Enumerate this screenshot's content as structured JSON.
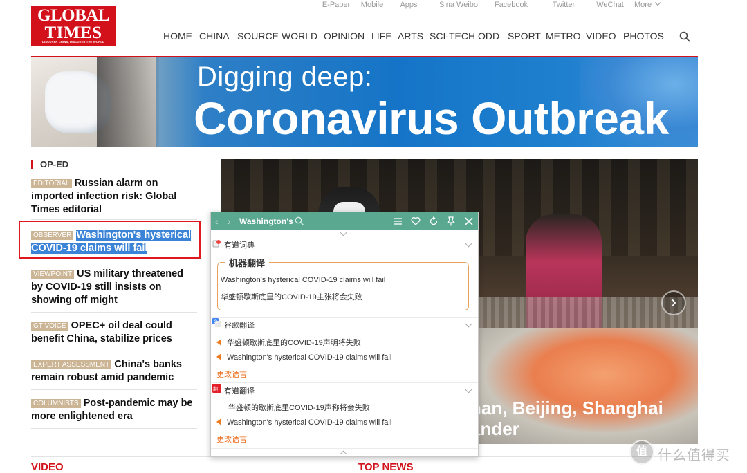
{
  "logo": {
    "line1": "GLOBAL",
    "line2": "TIMES",
    "tagline": "DISCOVER CHINA, DISCOVER THE WORLD"
  },
  "top_links": [
    "E-Paper",
    "Mobile",
    "Apps",
    "Sina Weibo",
    "Facebook",
    "Twitter",
    "WeChat",
    "More"
  ],
  "nav": [
    "HOME",
    "CHINA",
    "SOURCE",
    "WORLD",
    "OPINION",
    "LIFE",
    "ARTS",
    "SCI-TECH",
    "ODD",
    "SPORT",
    "METRO",
    "VIDEO",
    "PHOTOS"
  ],
  "banner": {
    "line1": "Digging deep:",
    "line2": "Coronavirus Outbreak"
  },
  "oped": {
    "title": "OP-ED",
    "stories": [
      {
        "tag": "EDITORIAL",
        "title": "Russian alarm on imported infection risk: Global Times editorial"
      },
      {
        "tag": "OBSERVER",
        "title": "Washington's hysterical COVID-19 claims will fail"
      },
      {
        "tag": "VIEWPOINT",
        "title": "US military threatened by COVID-19 still insists on showing off might"
      },
      {
        "tag": "GT VOICE",
        "title": "OPEC+ oil deal could benefit China, stabilize prices"
      },
      {
        "tag": "EXPERT ASSESSMENT",
        "title": "China's banks remain robust amid pandemic"
      },
      {
        "tag": "COLUMNISTS",
        "title": "Post-pandemic may be more enlightened era"
      }
    ]
  },
  "photo": {
    "caption_line1": "han, Beijing, Shanghai",
    "caption_line2": "ander",
    "next": "›"
  },
  "sections": {
    "video": "VIDEO",
    "top_news": "TOP NEWS"
  },
  "popup": {
    "query": "Washington's",
    "dict_name": "有道词典",
    "machine_title": "机器翻译",
    "machine_en": "Washington's hysterical COVID-19 claims will fail",
    "machine_zh": "华盛顿歇斯底里的COVID-19主张将会失败",
    "google_name": "谷歌翻译",
    "google_zh": "华盛顿歇斯底里的COVID-19声明将失败",
    "google_en": "Washington's hysterical COVID-19 claims will fail",
    "google_change": "更改语言",
    "youdao_name": "有道翻译",
    "youdao_zh": "华盛顿的歇斯底里COVID-19声称将会失败",
    "youdao_en": "Washington's hysterical COVID-19 claims will fail",
    "youdao_change": "更改语言"
  },
  "watermark": {
    "icon": "值",
    "text": "什么值得买"
  },
  "colors": {
    "brand_red": "#d2111b",
    "tag_bg": "#cbb594",
    "popup_bar": "#5aa88f",
    "highlight": "#3b83d6",
    "accent_orange": "#ec6d1c"
  }
}
